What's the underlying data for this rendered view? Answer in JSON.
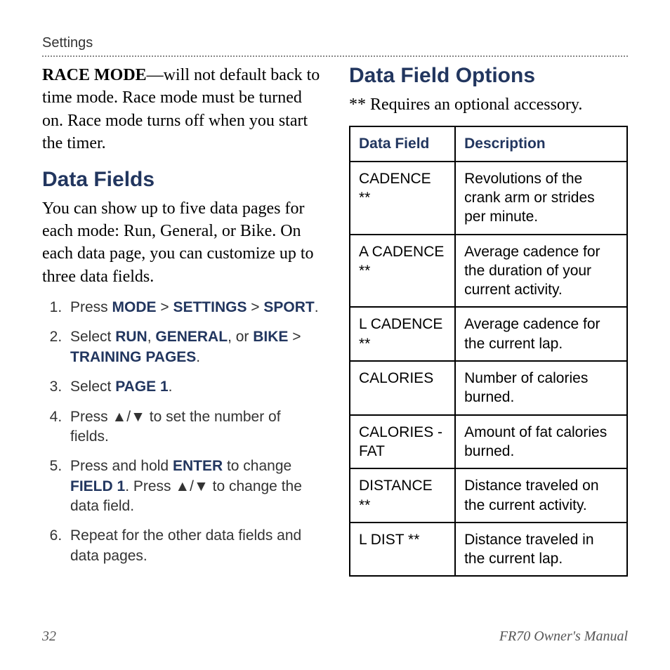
{
  "section_label": "Settings",
  "left": {
    "race_mode_label": "RACE MODE",
    "race_mode_text": "—will not default back to time mode. Race mode must be turned on. Race mode turns off when you start the timer.",
    "heading": "Data Fields",
    "intro": "You can show up to five data pages for each mode: Run, General, or Bike. On each data page, you can customize up to three data fields.",
    "step1_a": "Press ",
    "step1_mode": "MODE",
    "step1_sep1": " > ",
    "step1_settings": "SETTINGS",
    "step1_sep2": " > ",
    "step1_sport": "SPORT",
    "step1_end": ".",
    "step2_a": "Select ",
    "step2_run": "RUN",
    "step2_c1": ", ",
    "step2_general": "GENERAL",
    "step2_c2": ", or ",
    "step2_bike": "BIKE",
    "step2_sep": " > ",
    "step2_tp": "TRAINING PAGES",
    "step2_end": ".",
    "step3_a": "Select ",
    "step3_page1": "PAGE 1",
    "step3_end": ".",
    "step4_a": "Press ",
    "step4_arrows": "▲/▼",
    "step4_b": " to set the number of fields.",
    "step5_a": "Press and hold ",
    "step5_enter": "ENTER",
    "step5_b": " to change ",
    "step5_field1": "FIELD 1",
    "step5_c": ". Press ",
    "step5_arrows": "▲/▼",
    "step5_d": " to change the data field.",
    "step6": "Repeat for the other data fields and data pages."
  },
  "right": {
    "heading": "Data Field Options",
    "note": "** Requires an optional accessory.",
    "th_field": "Data Field",
    "th_desc": "Description",
    "rows": [
      {
        "field": "CADENCE **",
        "desc": "Revolutions of the crank arm or strides per minute."
      },
      {
        "field": "A CADENCE **",
        "desc": "Average cadence for the duration of your current activity."
      },
      {
        "field": "L CADENCE **",
        "desc": "Average cadence for the current lap."
      },
      {
        "field": "CALORIES",
        "desc": "Number of calories burned."
      },
      {
        "field": "CALORIES - FAT",
        "desc": "Amount of fat calories burned."
      },
      {
        "field": "DISTANCE **",
        "desc": "Distance traveled on the current activity."
      },
      {
        "field": "L DIST **",
        "desc": "Distance traveled in the current lap."
      }
    ]
  },
  "footer": {
    "page_no": "32",
    "manual": "FR70 Owner's Manual"
  }
}
